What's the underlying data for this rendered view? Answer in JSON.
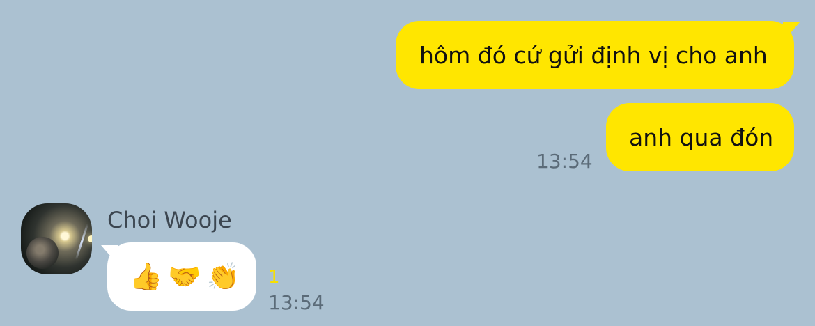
{
  "messages": {
    "sent_1": {
      "text": "hôm đó cứ gửi định vị cho anh"
    },
    "sent_2": {
      "text": "anh qua đón",
      "time": "13:54"
    },
    "received_1": {
      "sender": "Choi Wooje",
      "emojis": [
        "👍",
        "🤝",
        "👏"
      ],
      "unread": "1",
      "time": "13:54"
    }
  },
  "colors": {
    "background": "#abc1d1",
    "sent_bubble": "#ffe600",
    "received_bubble": "#ffffff",
    "timestamp": "#5b6b78",
    "unread_count": "#f7df00"
  }
}
